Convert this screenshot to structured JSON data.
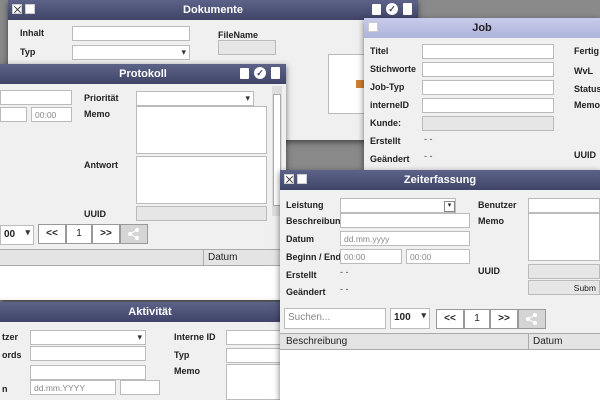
{
  "dokumente": {
    "title": "Dokumente",
    "inhalt_label": "Inhalt",
    "typ_label": "Typ",
    "filename_label": "FileName"
  },
  "job": {
    "title": "Job",
    "titel_label": "Titel",
    "stichworte_label": "Stichworte",
    "jobtyp_label": "Job-Typ",
    "internid_label": "interneID",
    "kunde_label": "Kunde:",
    "erstellt_label": "Erstellt",
    "erstellt_value": "- -",
    "geaendert_label": "Geändert",
    "geaendert_value": "- -",
    "fertig_label": "Fertig b",
    "wvl_label": "WvL",
    "status_label": "Status",
    "memo_label": "Memo",
    "uuid_label": "UUID"
  },
  "protokoll": {
    "title": "Protokoll",
    "time_value": "00:00",
    "prioritaet_label": "Priorität",
    "memo_label": "Memo",
    "antwort_label": "Antwort",
    "uuid_label": "UUID",
    "page_size": "00",
    "prev": "<<",
    "page": "1",
    "next": ">>",
    "col_datum": "Datum"
  },
  "aktivitaet": {
    "title": "Aktivität",
    "benutzer_label": "tzer",
    "keywords_label": "ords",
    "n_label": "n",
    "date_placeholder": "dd.mm.YYYY",
    "interne_id_label": "Interne ID",
    "typ_label": "Typ",
    "memo_label": "Memo"
  },
  "zeiterfassung": {
    "title": "Zeiterfassung",
    "leistung_label": "Leistung",
    "beschreibung_label": "Beschreibung",
    "datum_label": "Datum",
    "date_placeholder": "dd.mm.yyyy",
    "beginn_ende_label": "Beginn / Ende",
    "beginn_value": "00:00",
    "ende_value": "00:00",
    "erstellt_label": "Erstellt",
    "erstellt_value": "- -",
    "geaendert_label": "Geändert",
    "geaendert_value": "- -",
    "benutzer_label": "Benutzer",
    "memo_label": "Memo",
    "uuid_label": "UUID",
    "submit_label": "Subm",
    "search_placeholder": "Suchen...",
    "page_size": "100",
    "prev": "<<",
    "page": "1",
    "next": ">>",
    "col_beschreibung": "Beschreibung",
    "col_datum": "Datum"
  }
}
